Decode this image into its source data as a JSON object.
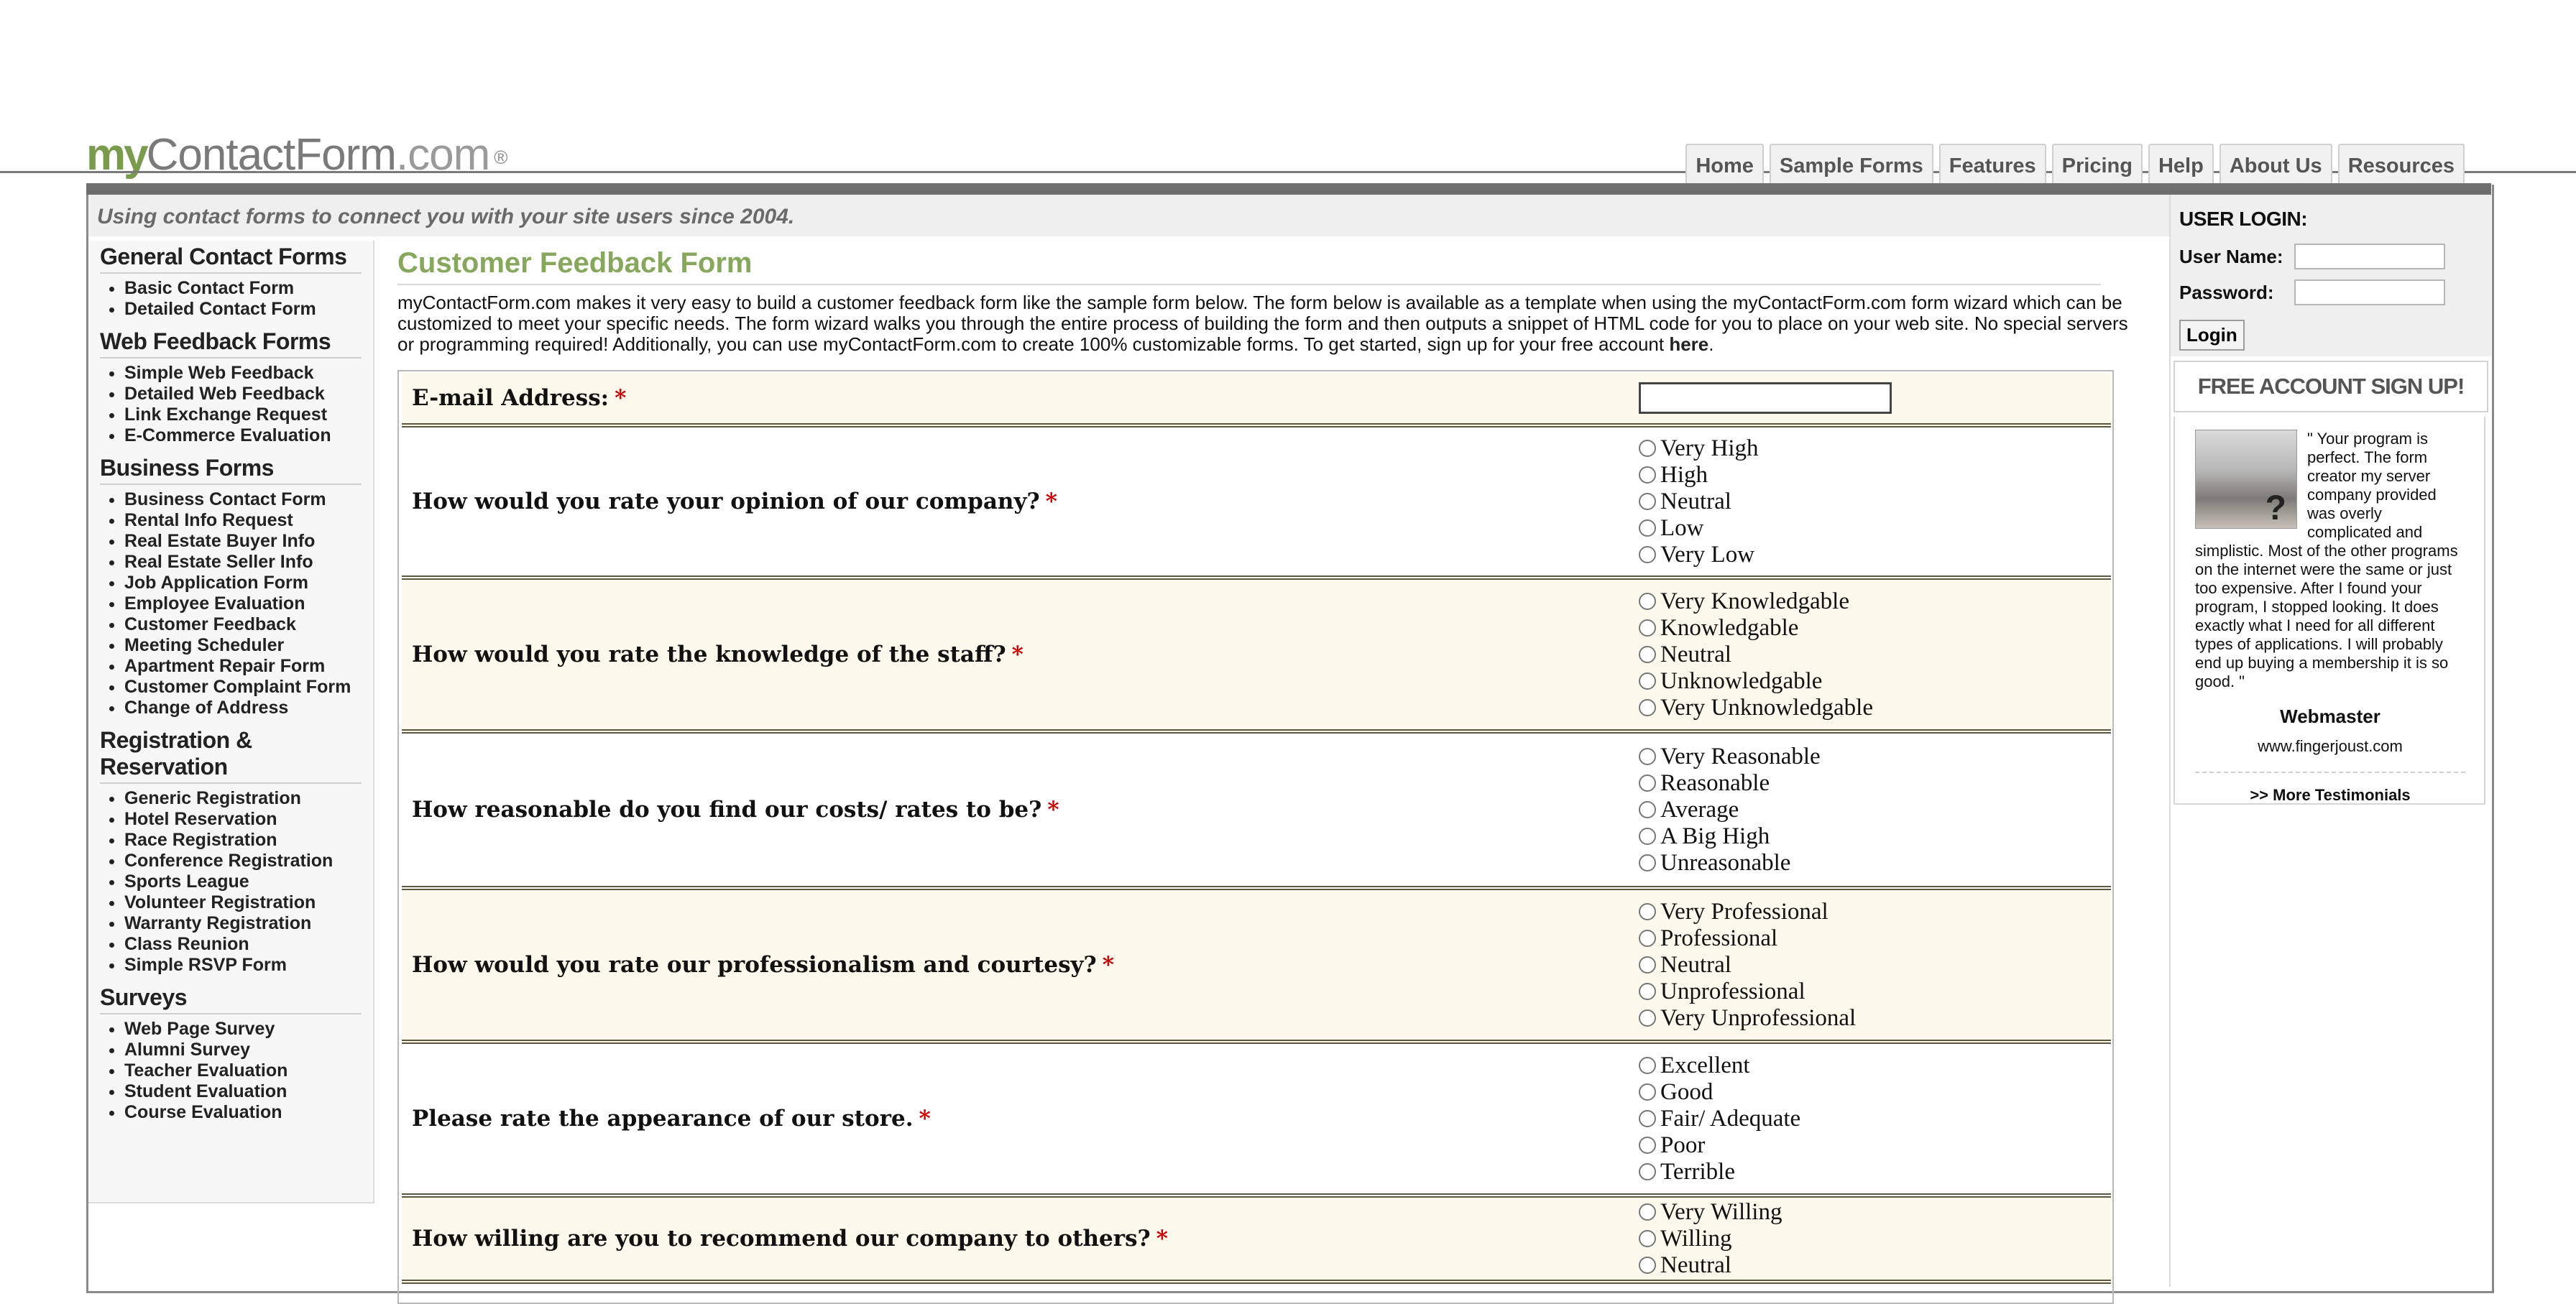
{
  "logo": {
    "my": "my",
    "rest": "ContactForm",
    "tld": ".com",
    "reg": "®"
  },
  "nav": {
    "items": [
      "Home",
      "Sample Forms",
      "Features",
      "Pricing",
      "Help",
      "About Us",
      "Resources"
    ]
  },
  "tagline": "Using contact forms to connect you with your site users since 2004.",
  "sidebar": {
    "categories": [
      {
        "title": "General Contact Forms",
        "items": [
          "Basic Contact Form",
          "Detailed Contact Form"
        ]
      },
      {
        "title": "Web Feedback Forms",
        "items": [
          "Simple Web Feedback",
          "Detailed Web Feedback",
          "Link Exchange Request",
          "E-Commerce Evaluation"
        ]
      },
      {
        "title": "Business Forms",
        "items": [
          "Business Contact Form",
          "Rental Info Request",
          "Real Estate Buyer Info",
          "Real Estate Seller Info",
          "Job Application Form",
          "Employee Evaluation",
          "Customer Feedback",
          "Meeting Scheduler",
          "Apartment Repair Form",
          "Customer Complaint Form",
          "Change of Address"
        ]
      },
      {
        "title": "Registration & Reservation",
        "items": [
          "Generic Registration",
          "Hotel Reservation",
          "Race Registration",
          "Conference Registration",
          "Sports League",
          "Volunteer Registration",
          "Warranty Registration",
          "Class Reunion",
          "Simple RSVP Form"
        ]
      },
      {
        "title": "Surveys",
        "items": [
          "Web Page Survey",
          "Alumni Survey",
          "Teacher Evaluation",
          "Student Evaluation",
          "Course Evaluation"
        ]
      }
    ]
  },
  "content": {
    "title": "Customer Feedback Form",
    "intro": "myContactForm.com makes it very easy to build a customer feedback form like the sample form below. The form below is available as a template when using the myContactForm.com form wizard which can be customized to meet your specific needs. The form wizard walks you through the entire process of building the form and then outputs a snippet of HTML code for you to place on your web site. No special servers or programming required! Additionally, you can use myContactForm.com to create 100% customizable forms. To get started, sign up for your free account ",
    "here_link": "here",
    "intro_end": "."
  },
  "form": {
    "required_mark": "*",
    "email_label": "E-mail Address:",
    "questions": [
      {
        "label": "How would you rate your opinion of our company?",
        "options": [
          "Very High",
          "High",
          "Neutral",
          "Low",
          "Very Low"
        ]
      },
      {
        "label": "How would you rate the knowledge of the staff?",
        "options": [
          "Very Knowledgable",
          "Knowledgable",
          "Neutral",
          "Unknowledgable",
          "Very Unknowledgable"
        ]
      },
      {
        "label": "How reasonable do you find our costs/ rates to be?",
        "options": [
          "Very Reasonable",
          "Reasonable",
          "Average",
          "A Big High",
          "Unreasonable"
        ]
      },
      {
        "label": "How would you rate our professionalism and courtesy?",
        "options": [
          "Very Professional",
          "Professional",
          "Neutral",
          "Unprofessional",
          "Very Unprofessional"
        ]
      },
      {
        "label": "Please rate the appearance of our store.",
        "options": [
          "Excellent",
          "Good",
          "Fair/ Adequate",
          "Poor",
          "Terrible"
        ]
      },
      {
        "label": "How willing are you to recommend our company to others?",
        "options": [
          "Very Willing",
          "Willing",
          "Neutral"
        ]
      }
    ]
  },
  "login": {
    "title": "USER LOGIN:",
    "username_label": "User Name:",
    "password_label": "Password:",
    "button": "Login"
  },
  "signup": {
    "label": "FREE ACCOUNT SIGN UP!"
  },
  "testimonial": {
    "quote": "\" Your program is perfect. The form creator my server company provided was overly complicated and simplistic. Most of the other programs on the internet were the same or just too expensive. After I found your program, I stopped looking. It does exactly what I need for all different types of applications. I will probably end up buying a membership it is so good. \"",
    "author": "Webmaster",
    "site": "www.fingerjoust.com",
    "more": ">> More Testimonials"
  }
}
